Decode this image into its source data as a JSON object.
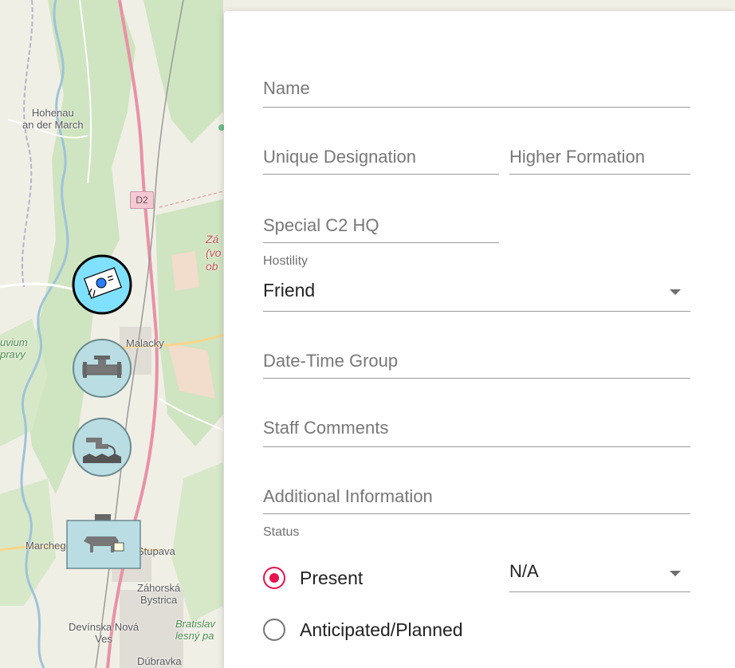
{
  "map": {
    "labels": {
      "hohenau": "Hohenau\nan der March",
      "malacky": "Malacky",
      "stupava": "Stupava",
      "marchegg": "Marchegg",
      "zahorska": "Záhorská\nBystrica",
      "devinska": "Devínska Nová\nVes",
      "dubravka": "Dúbravka",
      "bratislav": "Bratislav\nlesný pa",
      "alluvium": "uvium\npravy",
      "zah_red": "Zá\n(vo\nob",
      "road_d2": "D2"
    },
    "markers": [
      {
        "icon": "sensor-unit-icon",
        "selected": true
      },
      {
        "icon": "pipeline-unit-icon",
        "selected": false
      },
      {
        "icon": "water-supply-unit-icon",
        "selected": false
      },
      {
        "icon": "veterinary-unit-icon",
        "selected": false
      }
    ]
  },
  "form": {
    "name": {
      "placeholder": "Name",
      "value": ""
    },
    "unique_designation": {
      "placeholder": "Unique Designation",
      "value": ""
    },
    "higher_formation": {
      "placeholder": "Higher Formation",
      "value": ""
    },
    "special_c2_hq": {
      "placeholder": "Special C2 HQ",
      "value": ""
    },
    "hostility": {
      "label": "Hostility",
      "value": "Friend"
    },
    "date_time_group": {
      "placeholder": "Date-Time Group",
      "value": ""
    },
    "staff_comments": {
      "placeholder": "Staff Comments",
      "value": ""
    },
    "additional_information": {
      "placeholder": "Additional Information",
      "value": ""
    },
    "status": {
      "label": "Status",
      "options": [
        "Present",
        "Anticipated/Planned"
      ],
      "selected": "Present",
      "condition_value": "N/A"
    }
  },
  "colors": {
    "accent": "#e8124f",
    "friend_fill": "#80e0ff",
    "friend_fill_muted": "#b9dde2"
  }
}
